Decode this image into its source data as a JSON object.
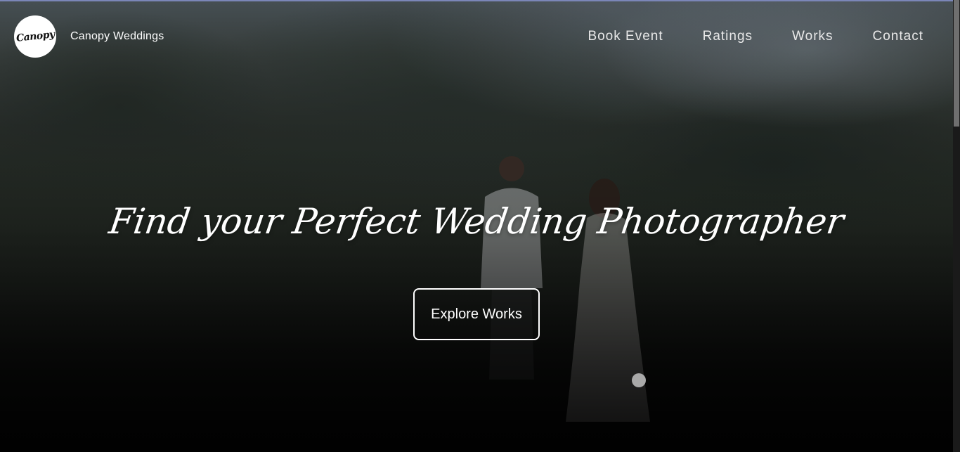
{
  "header": {
    "logo_text": "Canopy",
    "brand_name": "Canopy Weddings",
    "nav": [
      {
        "label": "Book Event"
      },
      {
        "label": "Ratings"
      },
      {
        "label": "Works"
      },
      {
        "label": "Contact"
      }
    ]
  },
  "hero": {
    "title": "Find your Perfect Wedding Photographer",
    "cta_label": "Explore Works"
  },
  "colors": {
    "accent_top_line": "#7b86b8",
    "text": "#ffffff",
    "slider_dot": "#a9a9a9"
  }
}
